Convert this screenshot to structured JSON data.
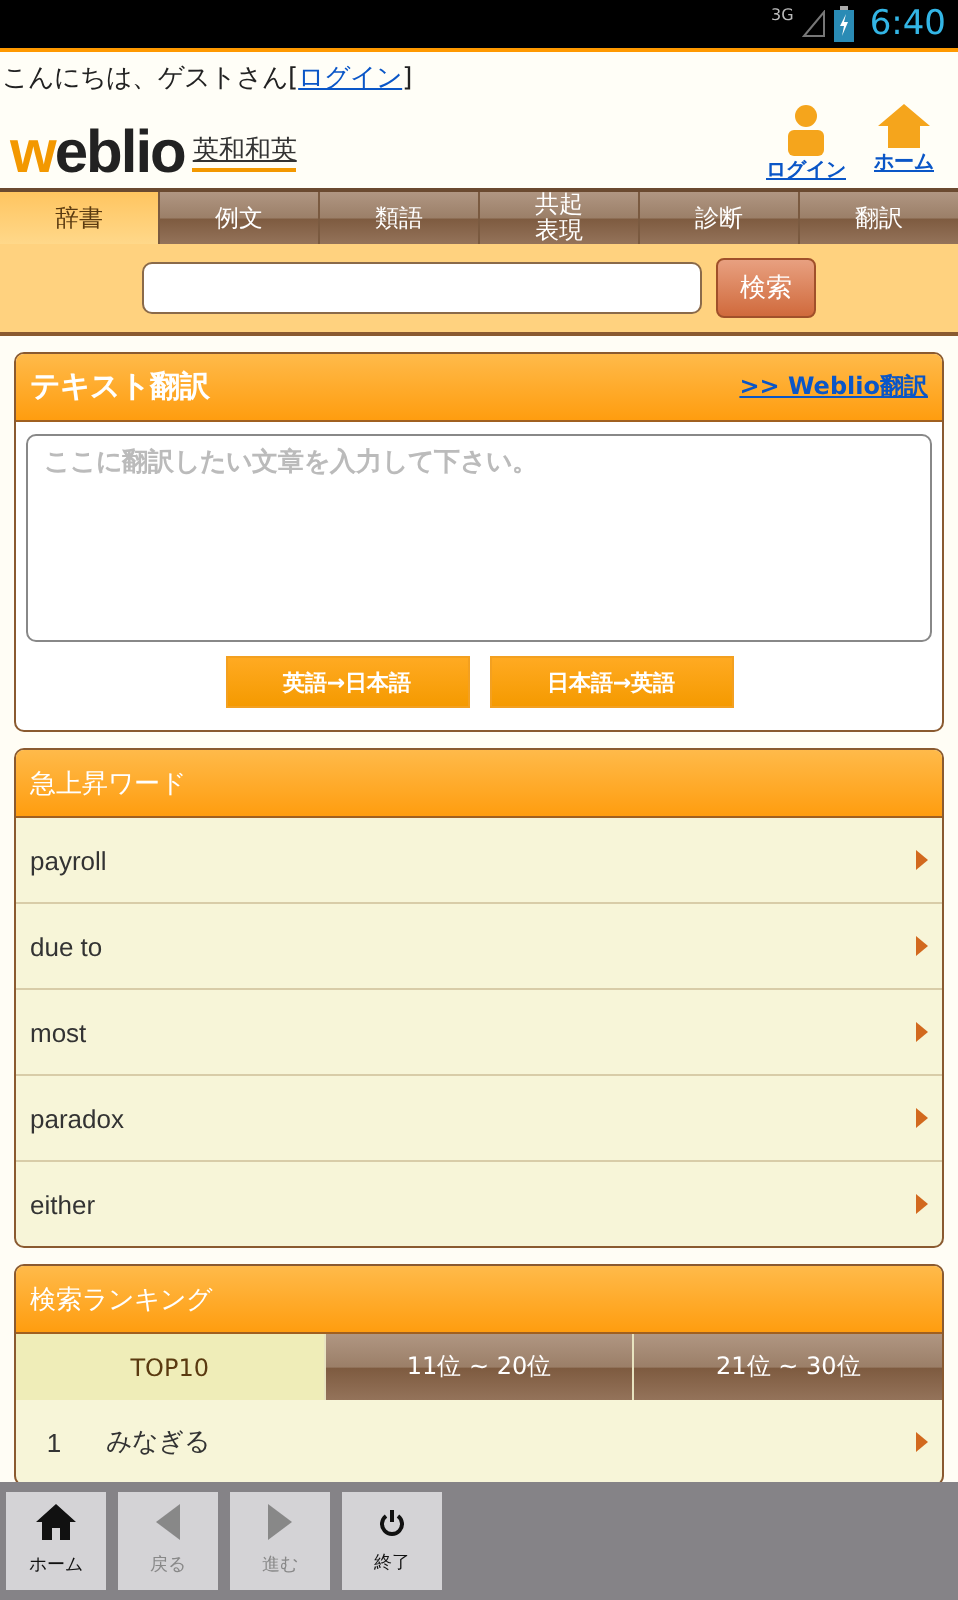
{
  "status_bar": {
    "network": "3G",
    "time": "6:40"
  },
  "greeting": {
    "text": "こんにちは、ゲストさん[",
    "link": "ログイン",
    "close": "]"
  },
  "header": {
    "logo": "weblio",
    "subtitle": "英和和英",
    "actions": [
      {
        "kind": "person",
        "label": "ログイン"
      },
      {
        "kind": "home",
        "label": "ホーム"
      }
    ]
  },
  "tabs": [
    {
      "label": "辞書",
      "selected": true
    },
    {
      "label": "例文",
      "selected": false
    },
    {
      "label": "類語",
      "selected": false
    },
    {
      "label": "共起表現",
      "selected": false
    },
    {
      "label": "診断",
      "selected": false
    },
    {
      "label": "翻訳",
      "selected": false
    }
  ],
  "search": {
    "button": "検索"
  },
  "translate": {
    "title": "テキスト翻訳",
    "link": ">> Weblio翻訳",
    "placeholder": "ここに翻訳したい文章を入力して下さい。",
    "buttons": [
      "英語→日本語",
      "日本語→英語"
    ]
  },
  "rising_words": {
    "title": "急上昇ワード",
    "items": [
      "payroll",
      "due to",
      "most",
      "paradox",
      "either"
    ]
  },
  "ranking": {
    "title": "検索ランキング",
    "tabs": [
      {
        "label": "TOP10",
        "selected": true
      },
      {
        "label": "11位 ~ 20位",
        "selected": false
      },
      {
        "label": "21位 ~ 30位",
        "selected": false
      }
    ],
    "items": [
      {
        "rank": "1",
        "word": "みなぎる"
      }
    ]
  },
  "toolbar": [
    {
      "kind": "home",
      "label": "ホーム",
      "disabled": false
    },
    {
      "kind": "back",
      "label": "戻る",
      "disabled": true
    },
    {
      "kind": "forward",
      "label": "進む",
      "disabled": true
    },
    {
      "kind": "power",
      "label": "終了",
      "disabled": false
    }
  ]
}
